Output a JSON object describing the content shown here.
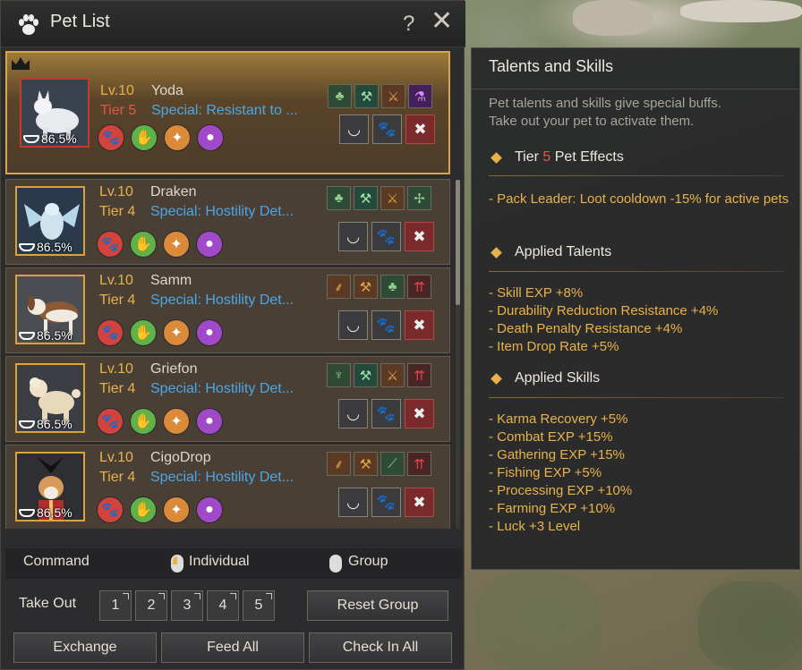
{
  "window": {
    "title": "Pet List",
    "help": "?",
    "close": "✕"
  },
  "pets": [
    {
      "level": "Lv.10",
      "tier": "Tier 5",
      "name": "Yoda",
      "special": "Special: Resistant to ...",
      "hunger": "86.5%",
      "leader": true,
      "talents": [
        "clover-icon",
        "pickaxe-icon",
        "axe-icon",
        "potion-icon"
      ]
    },
    {
      "level": "Lv.10",
      "tier": "Tier 4",
      "name": "Draken",
      "special": "Special: Hostility Det...",
      "hunger": "86.5%",
      "leader": false,
      "talents": [
        "clover-icon",
        "pickaxe-icon",
        "axe-icon",
        "compass-icon"
      ]
    },
    {
      "level": "Lv.10",
      "tier": "Tier 4",
      "name": "Samm",
      "special": "Special: Hostility Det...",
      "hunger": "86.5%",
      "leader": false,
      "talents": [
        "wheat-icon",
        "hammer-icon",
        "clover-icon",
        "arrows-up-icon"
      ]
    },
    {
      "level": "Lv.10",
      "tier": "Tier 4",
      "name": "Griefon",
      "special": "Special: Hostility Det...",
      "hunger": "86.5%",
      "leader": false,
      "talents": [
        "trap-icon",
        "pickaxe-icon",
        "axe-icon",
        "arrows-up-icon"
      ]
    },
    {
      "level": "Lv.10",
      "tier": "Tier 4",
      "name": "CigoDrop",
      "special": "Special: Hostility Det...",
      "hunger": "86.5%",
      "leader": false,
      "talents": [
        "wheat-icon",
        "hammer-icon",
        "wing-icon",
        "arrows-up-icon"
      ]
    }
  ],
  "command": {
    "label": "Command",
    "individual": "Individual",
    "group": "Group"
  },
  "take_out": {
    "label": "Take Out",
    "slots": [
      "1",
      "2",
      "3",
      "4",
      "5"
    ],
    "reset": "Reset Group"
  },
  "footer": {
    "exchange": "Exchange",
    "feed_all": "Feed All",
    "check_in_all": "Check In All"
  },
  "tooltip": {
    "title": "Talents and Skills",
    "desc1": "Pet talents and skills give special buffs.",
    "desc2": "Take out your pet to activate them.",
    "tier_prefix": "Tier ",
    "tier_num": "5",
    "tier_suffix": " Pet Effects",
    "tier_effect": "- Pack Leader: Loot cooldown -15% for active pets",
    "talents_head": "Applied Talents",
    "talents": [
      "- Skill EXP +8%",
      "- Durability Reduction Resistance +4%",
      "- Death Penalty Resistance +4%",
      "- Item Drop Rate +5%"
    ],
    "skills_head": "Applied Skills",
    "skills": [
      "- Karma Recovery +5%",
      "- Combat EXP +15%",
      "- Gathering EXP +15%",
      "- Fishing EXP +5%",
      "- Processing EXP +10%",
      "- Farming EXP +10%",
      "- Luck +3 Level"
    ]
  },
  "colors": {
    "gold": "#e8b24a",
    "special": "#4aa7e8",
    "tier5": "#e2564a"
  }
}
